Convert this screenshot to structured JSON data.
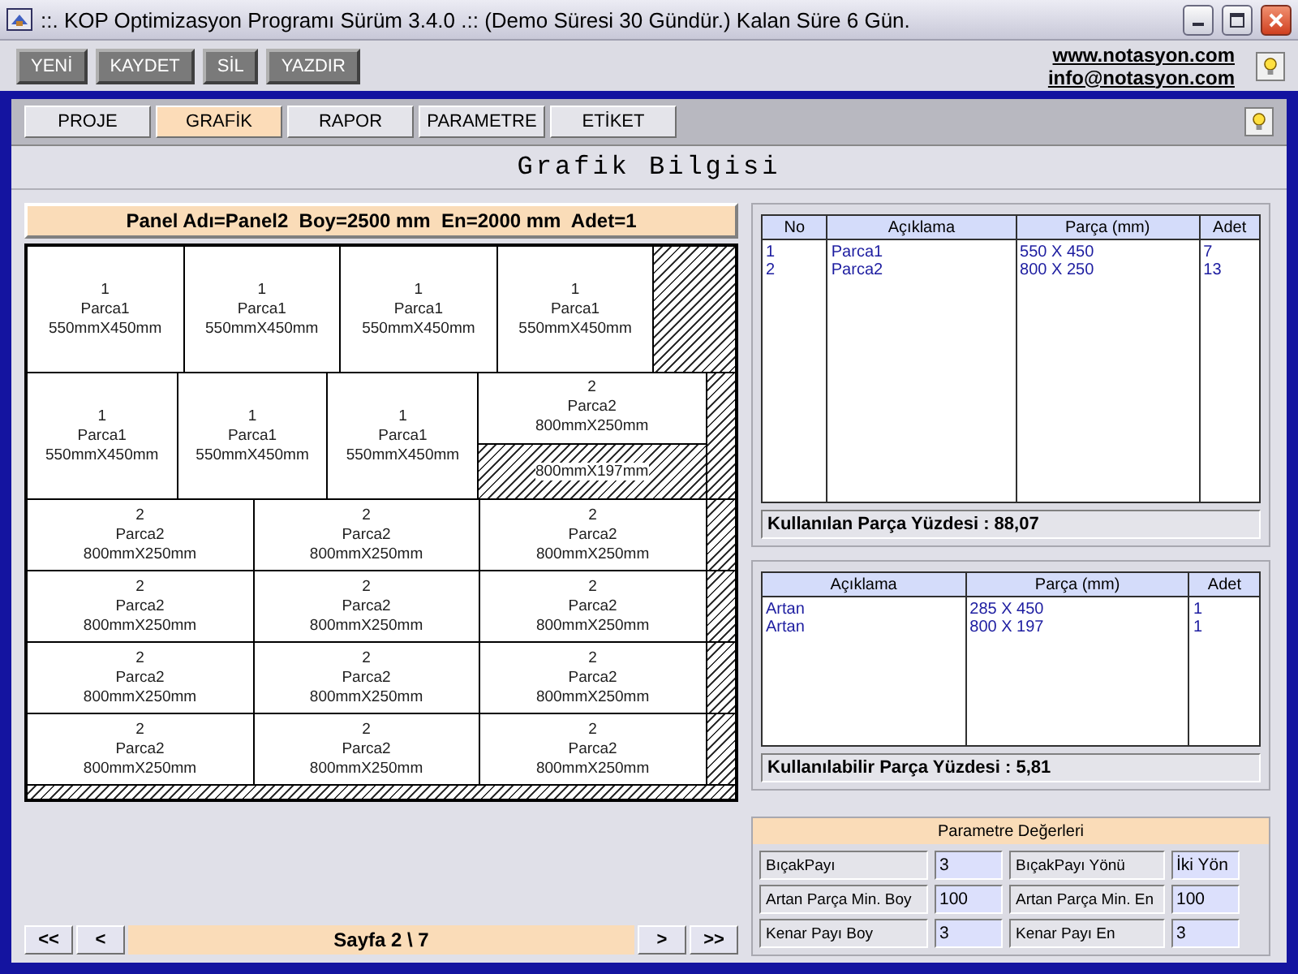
{
  "window": {
    "title": "::. KOP Optimizasyon Programı Sürüm 3.4.0 .:: (Demo Süresi 30 Gündür.)  Kalan Süre 6 Gün."
  },
  "toolbar": {
    "buttons": [
      "YENİ",
      "KAYDET",
      "SİL",
      "YAZDIR"
    ],
    "links": [
      "www.notasyon.com",
      "info@notasyon.com"
    ]
  },
  "tabs": [
    {
      "label": "PROJE",
      "selected": false
    },
    {
      "label": "GRAFİK",
      "selected": true
    },
    {
      "label": "RAPOR",
      "selected": false
    },
    {
      "label": "PARAMETRE",
      "selected": false
    },
    {
      "label": "ETİKET",
      "selected": false
    }
  ],
  "heading": "Grafik Bilgisi",
  "panel": {
    "caption": "Panel Adı=Panel2  Boy=2500 mm  En=2000 mm  Adet=1",
    "strips": [
      {
        "kind": "tall",
        "cells": [
          {
            "kind": "part",
            "number": "1",
            "name": "Parca1",
            "size": "550mmX450mm"
          },
          {
            "kind": "part",
            "number": "1",
            "name": "Parca1",
            "size": "550mmX450mm"
          },
          {
            "kind": "part",
            "number": "1",
            "name": "Parca1",
            "size": "550mmX450mm"
          },
          {
            "kind": "part",
            "number": "1",
            "name": "Parca1",
            "size": "550mmX450mm"
          },
          {
            "kind": "waste"
          }
        ]
      },
      {
        "kind": "tall",
        "cells": [
          {
            "kind": "part",
            "number": "1",
            "name": "Parca1",
            "size": "550mmX450mm"
          },
          {
            "kind": "part",
            "number": "1",
            "name": "Parca1",
            "size": "550mmX450mm"
          },
          {
            "kind": "part",
            "number": "1",
            "name": "Parca1",
            "size": "550mmX450mm"
          },
          {
            "kind": "stack",
            "cells": [
              {
                "kind": "part",
                "number": "2",
                "name": "Parca2",
                "size": "800mmX250mm"
              },
              {
                "kind": "waste",
                "size": "800mmX197mm"
              }
            ]
          },
          {
            "kind": "waste"
          }
        ]
      },
      {
        "kind": "short",
        "cells": [
          {
            "kind": "part",
            "number": "2",
            "name": "Parca2",
            "size": "800mmX250mm"
          },
          {
            "kind": "part",
            "number": "2",
            "name": "Parca2",
            "size": "800mmX250mm"
          },
          {
            "kind": "part",
            "number": "2",
            "name": "Parca2",
            "size": "800mmX250mm"
          },
          {
            "kind": "waste"
          }
        ]
      },
      {
        "kind": "short",
        "cells": [
          {
            "kind": "part",
            "number": "2",
            "name": "Parca2",
            "size": "800mmX250mm"
          },
          {
            "kind": "part",
            "number": "2",
            "name": "Parca2",
            "size": "800mmX250mm"
          },
          {
            "kind": "part",
            "number": "2",
            "name": "Parca2",
            "size": "800mmX250mm"
          },
          {
            "kind": "waste"
          }
        ]
      },
      {
        "kind": "short",
        "cells": [
          {
            "kind": "part",
            "number": "2",
            "name": "Parca2",
            "size": "800mmX250mm"
          },
          {
            "kind": "part",
            "number": "2",
            "name": "Parca2",
            "size": "800mmX250mm"
          },
          {
            "kind": "part",
            "number": "2",
            "name": "Parca2",
            "size": "800mmX250mm"
          },
          {
            "kind": "waste"
          }
        ]
      },
      {
        "kind": "short",
        "cells": [
          {
            "kind": "part",
            "number": "2",
            "name": "Parca2",
            "size": "800mmX250mm"
          },
          {
            "kind": "part",
            "number": "2",
            "name": "Parca2",
            "size": "800mmX250mm"
          },
          {
            "kind": "part",
            "number": "2",
            "name": "Parca2",
            "size": "800mmX250mm"
          },
          {
            "kind": "waste"
          }
        ]
      },
      {
        "kind": "edge",
        "cells": [
          {
            "kind": "waste"
          }
        ]
      }
    ]
  },
  "pager": {
    "first": "<<",
    "prev": "<",
    "label": "Sayfa 2 \\ 7",
    "next": ">",
    "last": ">>"
  },
  "parts_table": {
    "columns": [
      "No",
      "Açıklama",
      "Parça (mm)",
      "Adet"
    ],
    "rows": [
      [
        "1",
        "Parca1",
        "550 X 450",
        "7"
      ],
      [
        "2",
        "Parca2",
        "800 X 250",
        "13"
      ]
    ],
    "summary": "Kullanılan Parça Yüzdesi : 88,07"
  },
  "offcuts_table": {
    "columns": [
      "Açıklama",
      "Parça (mm)",
      "Adet"
    ],
    "rows": [
      [
        "Artan",
        "285 X 450",
        "1"
      ],
      [
        "Artan",
        "800 X 197",
        "1"
      ]
    ],
    "summary": "Kullanılabilir Parça Yüzdesi : 5,81"
  },
  "parameters": {
    "title": "Parametre Değerleri",
    "items": [
      {
        "label": "BıçakPayı",
        "value": "3"
      },
      {
        "label": "BıçakPayı Yönü",
        "value": "İki Yön"
      },
      {
        "label": "Artan Parça Min. Boy",
        "value": "100"
      },
      {
        "label": "Artan Parça Min. En",
        "value": "100"
      },
      {
        "label": "Kenar Payı  Boy",
        "value": "3"
      },
      {
        "label": "Kenar Payı En",
        "value": "3"
      }
    ]
  }
}
